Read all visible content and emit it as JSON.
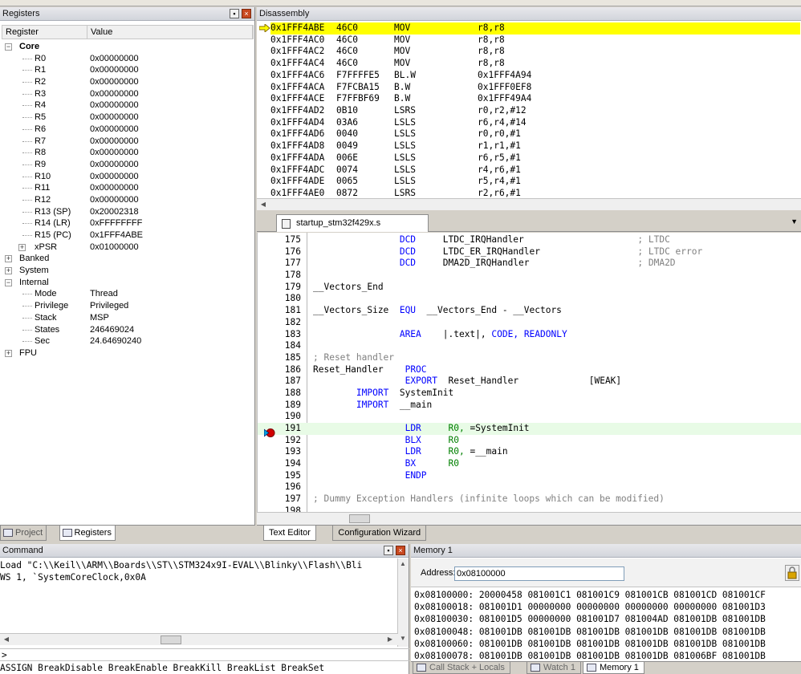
{
  "registers": {
    "title": "Registers",
    "col_register": "Register",
    "col_value": "Value",
    "tree": [
      {
        "name": "Core",
        "value": "",
        "level": 0,
        "exp": "-",
        "bold": true
      },
      {
        "name": "R0",
        "value": "0x00000000",
        "level": 1
      },
      {
        "name": "R1",
        "value": "0x00000000",
        "level": 1
      },
      {
        "name": "R2",
        "value": "0x00000000",
        "level": 1
      },
      {
        "name": "R3",
        "value": "0x00000000",
        "level": 1
      },
      {
        "name": "R4",
        "value": "0x00000000",
        "level": 1
      },
      {
        "name": "R5",
        "value": "0x00000000",
        "level": 1
      },
      {
        "name": "R6",
        "value": "0x00000000",
        "level": 1
      },
      {
        "name": "R7",
        "value": "0x00000000",
        "level": 1
      },
      {
        "name": "R8",
        "value": "0x00000000",
        "level": 1
      },
      {
        "name": "R9",
        "value": "0x00000000",
        "level": 1
      },
      {
        "name": "R10",
        "value": "0x00000000",
        "level": 1
      },
      {
        "name": "R11",
        "value": "0x00000000",
        "level": 1
      },
      {
        "name": "R12",
        "value": "0x00000000",
        "level": 1
      },
      {
        "name": "R13 (SP)",
        "value": "0x20002318",
        "level": 1
      },
      {
        "name": "R14 (LR)",
        "value": "0xFFFFFFFF",
        "level": 1
      },
      {
        "name": "R15 (PC)",
        "value": "0x1FFF4ABE",
        "level": 1
      },
      {
        "name": "xPSR",
        "value": "0x01000000",
        "level": 1,
        "exp": "+"
      },
      {
        "name": "Banked",
        "value": "",
        "level": 0,
        "exp": "+"
      },
      {
        "name": "System",
        "value": "",
        "level": 0,
        "exp": "+"
      },
      {
        "name": "Internal",
        "value": "",
        "level": 0,
        "exp": "-"
      },
      {
        "name": "Mode",
        "value": "Thread",
        "level": 1
      },
      {
        "name": "Privilege",
        "value": "Privileged",
        "level": 1
      },
      {
        "name": "Stack",
        "value": "MSP",
        "level": 1
      },
      {
        "name": "States",
        "value": "246469024",
        "level": 1
      },
      {
        "name": "Sec",
        "value": "24.64690240",
        "level": 1
      },
      {
        "name": "FPU",
        "value": "",
        "level": 0,
        "exp": "+"
      }
    ]
  },
  "left_tabs": [
    {
      "label": "Project",
      "active": false
    },
    {
      "label": "Registers",
      "active": true
    }
  ],
  "disassembly": {
    "title": "Disassembly",
    "rows": [
      {
        "addr": "0x1FFF4ABE",
        "code": "46C0",
        "mnem": "MOV",
        "ops": "r8,r8",
        "current": true
      },
      {
        "addr": "0x1FFF4AC0",
        "code": "46C0",
        "mnem": "MOV",
        "ops": "r8,r8"
      },
      {
        "addr": "0x1FFF4AC2",
        "code": "46C0",
        "mnem": "MOV",
        "ops": "r8,r8"
      },
      {
        "addr": "0x1FFF4AC4",
        "code": "46C0",
        "mnem": "MOV",
        "ops": "r8,r8"
      },
      {
        "addr": "0x1FFF4AC6",
        "code": "F7FFFFE5",
        "mnem": "BL.W",
        "ops": "0x1FFF4A94"
      },
      {
        "addr": "0x1FFF4ACA",
        "code": "F7FCBA15",
        "mnem": "B.W",
        "ops": "0x1FFF0EF8"
      },
      {
        "addr": "0x1FFF4ACE",
        "code": "F7FFBF69",
        "mnem": "B.W",
        "ops": "0x1FFF49A4"
      },
      {
        "addr": "0x1FFF4AD2",
        "code": "0B10",
        "mnem": "LSRS",
        "ops": "r0,r2,#12"
      },
      {
        "addr": "0x1FFF4AD4",
        "code": "03A6",
        "mnem": "LSLS",
        "ops": "r6,r4,#14"
      },
      {
        "addr": "0x1FFF4AD6",
        "code": "0040",
        "mnem": "LSLS",
        "ops": "r0,r0,#1"
      },
      {
        "addr": "0x1FFF4AD8",
        "code": "0049",
        "mnem": "LSLS",
        "ops": "r1,r1,#1"
      },
      {
        "addr": "0x1FFF4ADA",
        "code": "006E",
        "mnem": "LSLS",
        "ops": "r6,r5,#1"
      },
      {
        "addr": "0x1FFF4ADC",
        "code": "0074",
        "mnem": "LSLS",
        "ops": "r4,r6,#1"
      },
      {
        "addr": "0x1FFF4ADE",
        "code": "0065",
        "mnem": "LSLS",
        "ops": "r5,r4,#1"
      },
      {
        "addr": "0x1FFF4AE0",
        "code": "0872",
        "mnem": "LSRS",
        "ops": "r2,r6,#1"
      }
    ]
  },
  "editor": {
    "file_tab": "startup_stm32f429x.s",
    "lines": [
      {
        "n": "175",
        "parts": [
          {
            "t": "DCD",
            "c": "kw",
            "col": 16
          },
          {
            "t": "LTDC_IRQHandler",
            "col": 24
          },
          {
            "t": "; LTDC",
            "c": "cm",
            "col": 60
          }
        ]
      },
      {
        "n": "176",
        "parts": [
          {
            "t": "DCD",
            "c": "kw",
            "col": 16
          },
          {
            "t": "LTDC_ER_IRQHandler",
            "col": 24
          },
          {
            "t": "; LTDC error",
            "c": "cm",
            "col": 60
          }
        ]
      },
      {
        "n": "177",
        "parts": [
          {
            "t": "DCD",
            "c": "kw",
            "col": 16
          },
          {
            "t": "DMA2D_IRQHandler",
            "col": 24
          },
          {
            "t": "; DMA2D",
            "c": "cm",
            "col": 60
          }
        ]
      },
      {
        "n": "178",
        "parts": []
      },
      {
        "n": "179",
        "parts": [
          {
            "t": "__Vectors_End",
            "col": 0
          }
        ]
      },
      {
        "n": "180",
        "parts": []
      },
      {
        "n": "181",
        "parts": [
          {
            "t": "__Vectors_Size",
            "col": 0
          },
          {
            "t": "EQU",
            "c": "kw",
            "col": 16
          },
          {
            "t": "__Vectors_End - __Vectors",
            "col": 21
          }
        ]
      },
      {
        "n": "182",
        "parts": []
      },
      {
        "n": "183",
        "parts": [
          {
            "t": "AREA",
            "c": "kw",
            "col": 16
          },
          {
            "t": "|.text|,",
            "col": 24
          },
          {
            "t": "CODE, READONLY",
            "c": "kw",
            "col": 33
          }
        ]
      },
      {
        "n": "184",
        "parts": []
      },
      {
        "n": "185",
        "parts": [
          {
            "t": "; Reset handler",
            "c": "cm",
            "col": 0
          }
        ]
      },
      {
        "n": "186",
        "parts": [
          {
            "t": "Reset_Handler",
            "col": 0
          },
          {
            "t": "PROC",
            "c": "kw",
            "col": 17
          }
        ]
      },
      {
        "n": "187",
        "parts": [
          {
            "t": "EXPORT",
            "c": "kw",
            "col": 17
          },
          {
            "t": "Reset_Handler",
            "col": 25
          },
          {
            "t": "[WEAK]",
            "col": 51
          }
        ]
      },
      {
        "n": "188",
        "parts": [
          {
            "t": "IMPORT",
            "c": "kw",
            "col": 8
          },
          {
            "t": "SystemInit",
            "col": 16
          }
        ]
      },
      {
        "n": "189",
        "parts": [
          {
            "t": "IMPORT",
            "c": "kw",
            "col": 8
          },
          {
            "t": "__main",
            "col": 16
          }
        ]
      },
      {
        "n": "190",
        "parts": []
      },
      {
        "n": "191",
        "parts": [
          {
            "t": "LDR",
            "c": "kw",
            "col": 17
          },
          {
            "t": "R0,",
            "c": "rg",
            "col": 25
          },
          {
            "t": "=SystemInit",
            "col": 29
          }
        ],
        "hl": true
      },
      {
        "n": "192",
        "parts": [
          {
            "t": "BLX",
            "c": "kw",
            "col": 17
          },
          {
            "t": "R0",
            "c": "rg",
            "col": 25
          }
        ]
      },
      {
        "n": "193",
        "parts": [
          {
            "t": "LDR",
            "c": "kw",
            "col": 17
          },
          {
            "t": "R0,",
            "c": "rg",
            "col": 25
          },
          {
            "t": "=__main",
            "col": 29
          }
        ]
      },
      {
        "n": "194",
        "parts": [
          {
            "t": "BX",
            "c": "kw",
            "col": 17
          },
          {
            "t": "R0",
            "c": "rg",
            "col": 25
          }
        ]
      },
      {
        "n": "195",
        "parts": [
          {
            "t": "ENDP",
            "c": "kw",
            "col": 17
          }
        ]
      },
      {
        "n": "196",
        "parts": []
      },
      {
        "n": "197",
        "parts": [
          {
            "t": "; Dummy Exception Handlers (infinite loops which can be modified)",
            "c": "cm",
            "col": 0
          }
        ]
      },
      {
        "n": "198",
        "parts": []
      }
    ]
  },
  "editor_tabs": [
    {
      "label": "Text Editor",
      "active": true
    },
    {
      "label": "Configuration Wizard",
      "active": false
    }
  ],
  "command": {
    "title": "Command",
    "output": [
      "Load \"C:\\\\Keil\\\\ARM\\\\Boards\\\\ST\\\\STM324x9I-EVAL\\\\Blinky\\\\Flash\\\\Bli",
      "WS 1, `SystemCoreClock,0x0A"
    ],
    "prompt": ">",
    "help": "ASSIGN BreakDisable BreakEnable BreakKill BreakList BreakSet"
  },
  "memory": {
    "title": "Memory 1",
    "address_label": "Address:",
    "address_value": "0x08100000",
    "rows": [
      "0x08100000: 20000458 081001C1 081001C9 081001CB 081001CD 081001CF",
      "0x08100018: 081001D1 00000000 00000000 00000000 00000000 081001D3",
      "0x08100030: 081001D5 00000000 081001D7 081004AD 081001DB 081001DB",
      "0x08100048: 081001DB 081001DB 081001DB 081001DB 081001DB 081001DB",
      "0x08100060: 081001DB 081001DB 081001DB 081001DB 081001DB 081001DB",
      "0x08100078: 081001DB 081001DB 081001DB 081001DB 081006BF 081001DB"
    ],
    "tabs": [
      {
        "label": "Call Stack + Locals",
        "active": false
      },
      {
        "label": "Watch 1",
        "active": false
      },
      {
        "label": "Memory 1",
        "active": true
      }
    ]
  },
  "colors": {
    "current_line": "#ffff00",
    "breakpoint_line": "#e8fbe6",
    "keyword": "#0000ff",
    "comment": "#808080",
    "register": "#008000"
  }
}
